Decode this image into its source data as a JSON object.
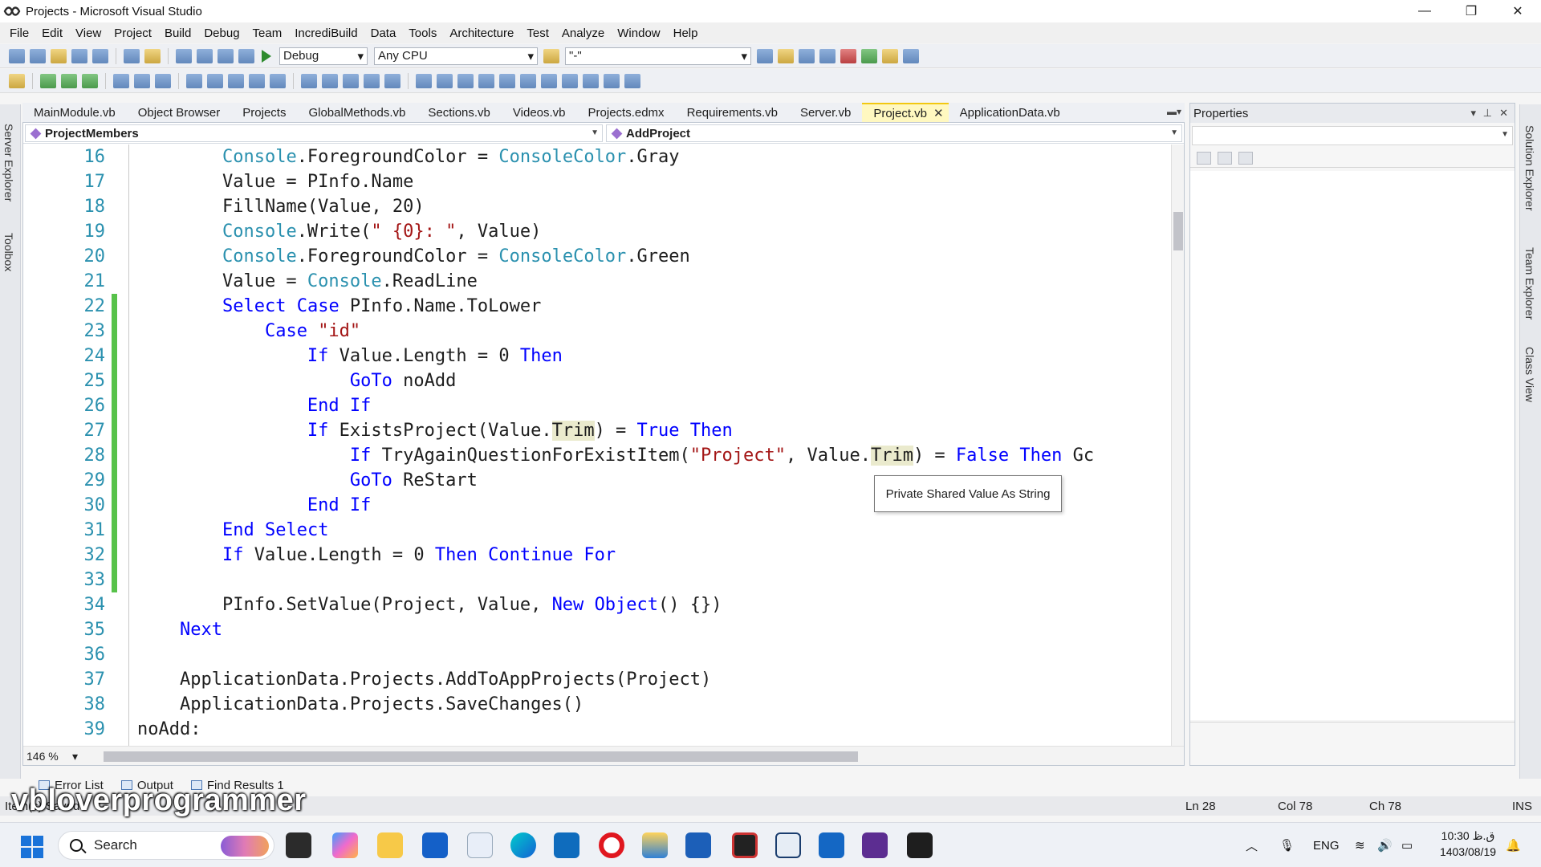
{
  "window": {
    "title": "Projects - Microsoft Visual Studio",
    "minimize": "—",
    "maximize": "❐",
    "close": "✕"
  },
  "menu": [
    "File",
    "Edit",
    "View",
    "Project",
    "Build",
    "Debug",
    "Team",
    "IncrediBuild",
    "Data",
    "Tools",
    "Architecture",
    "Test",
    "Analyze",
    "Window",
    "Help"
  ],
  "toolbar": {
    "config": "Debug",
    "platform": "Any CPU",
    "find": "\"-\""
  },
  "tabs": [
    "MainModule.vb",
    "Object Browser",
    "Projects",
    "GlobalMethods.vb",
    "Sections.vb",
    "Videos.vb",
    "Projects.edmx",
    "Requirements.vb",
    "Server.vb",
    "Project.vb",
    "ApplicationData.vb"
  ],
  "active_tab_index": 9,
  "editor": {
    "class_combo": "ProjectMembers",
    "member_combo": "AddProject",
    "zoom": "146 %",
    "tooltip": "Private Shared Value As String",
    "lines": [
      {
        "n": "16",
        "t": "        Console.ForegroundColor = ConsoleColor.Gray"
      },
      {
        "n": "17",
        "t": "        Value = PInfo.Name"
      },
      {
        "n": "18",
        "t": "        FillName(Value, 20)"
      },
      {
        "n": "19",
        "t": "        Console.Write(\" {0}: \", Value)"
      },
      {
        "n": "20",
        "t": "        Console.ForegroundColor = ConsoleColor.Green"
      },
      {
        "n": "21",
        "t": "        Value = Console.ReadLine"
      },
      {
        "n": "22",
        "t": "        Select Case PInfo.Name.ToLower"
      },
      {
        "n": "23",
        "t": "            Case \"id\""
      },
      {
        "n": "24",
        "t": "                If Value.Length = 0 Then"
      },
      {
        "n": "25",
        "t": "                    GoTo noAdd"
      },
      {
        "n": "26",
        "t": "                End If"
      },
      {
        "n": "27",
        "t": "                If ExistsProject(Value.Trim) = True Then"
      },
      {
        "n": "28",
        "t": "                    If TryAgainQuestionForExistItem(\"Project\", Value.Trim) = False Then Gc"
      },
      {
        "n": "29",
        "t": "                    GoTo ReStart"
      },
      {
        "n": "30",
        "t": "                End If"
      },
      {
        "n": "31",
        "t": "        End Select"
      },
      {
        "n": "32",
        "t": "        If Value.Length = 0 Then Continue For"
      },
      {
        "n": "33",
        "t": ""
      },
      {
        "n": "34",
        "t": "        PInfo.SetValue(Project, Value, New Object() {})"
      },
      {
        "n": "35",
        "t": "    Next"
      },
      {
        "n": "36",
        "t": ""
      },
      {
        "n": "37",
        "t": "    ApplicationData.Projects.AddToAppProjects(Project)"
      },
      {
        "n": "38",
        "t": "    ApplicationData.Projects.SaveChanges()"
      },
      {
        "n": "39",
        "t": "noAdd:"
      }
    ]
  },
  "side": {
    "left1": "Server Explorer",
    "left2": "Toolbox",
    "right1": "Solution Explorer",
    "right2": "Team Explorer",
    "right3": "Class View"
  },
  "properties": {
    "title": "Properties"
  },
  "bottom_tabs": [
    "Error List",
    "Output",
    "Find Results 1"
  ],
  "status": {
    "left": "Item(s) Saved",
    "ln": "Ln 28",
    "col": "Col 78",
    "ch": "Ch 78",
    "ins": "INS"
  },
  "watermark": "vbloverprogrammer",
  "taskbar": {
    "search": "Search",
    "lang": "ENG",
    "time": "10:30 ق.ظ",
    "date": "1403/08/19"
  },
  "colors": {
    "accent": "#f2c811",
    "keyword": "#0000ff",
    "type": "#2b91af",
    "string": "#a31515",
    "change_bar": "#57c24a"
  }
}
